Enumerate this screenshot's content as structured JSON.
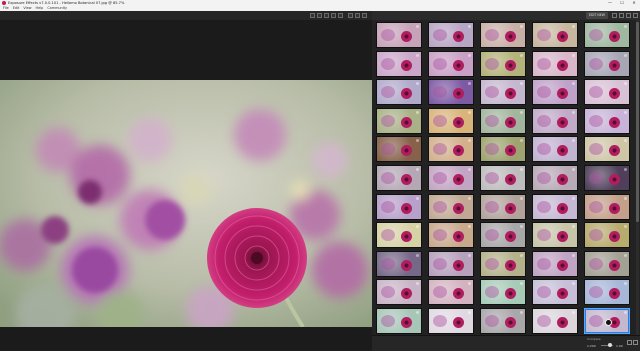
{
  "window": {
    "title": "Exposure Effects v7.0.0.101 - Hellomo Botanical 07.jpg @ 85.7%",
    "controls": [
      "—",
      "☐",
      "✕"
    ]
  },
  "menu": [
    "File",
    "Edit",
    "View",
    "Help",
    "Community"
  ],
  "grid_toolbar": {
    "edit_label": "EDIT NEW"
  },
  "panel_footer": {
    "label": "Compare",
    "zoom_label": "1:200",
    "zoom_value": "1.00"
  },
  "preview": {
    "subject": "pink dahlia photograph"
  },
  "grid": {
    "columns": 5,
    "rows": 11,
    "selected_index": 54,
    "tiles": [
      "#c6a3b8",
      "#b7a6c4",
      "#c9b0a7",
      "#c7b7a0",
      "#9fb8a0",
      "#caa7c9",
      "#c8a0c5",
      "#b3b27a",
      "#d8b7c9",
      "#a7a6b5",
      "#b1aacb",
      "#7d5aa4",
      "#c5b7cf",
      "#bfa2c9",
      "#d8c1d5",
      "#a9b187",
      "#d8b47a",
      "#a2b59d",
      "#c0aac8",
      "#c7b4d8",
      "#87614a",
      "#d2b08c",
      "#9ea36f",
      "#c2b3d1",
      "#cfc6a8",
      "#b5a8b5",
      "#c2a5c3",
      "#bdbdbd",
      "#b8aab7",
      "#4f3f5a",
      "#b7a0c9",
      "#c1a894",
      "#b1a39c",
      "#c6b8d3",
      "#c4a08a",
      "#d7d2a6",
      "#c8a98c",
      "#a8a8a8",
      "#c7c5a8",
      "#b8ab6e",
      "#766888",
      "#b6a0bc",
      "#b3b28b",
      "#c0a4c3",
      "#a3a094",
      "#c9b4c7",
      "#d4b3c1",
      "#a8cbb8",
      "#c6bfd7",
      "#a7b7d8",
      "#a7c6b8",
      "#e1d9e2",
      "#a9a7a9",
      "#dcd6dc",
      "#c4b8cf"
    ]
  }
}
